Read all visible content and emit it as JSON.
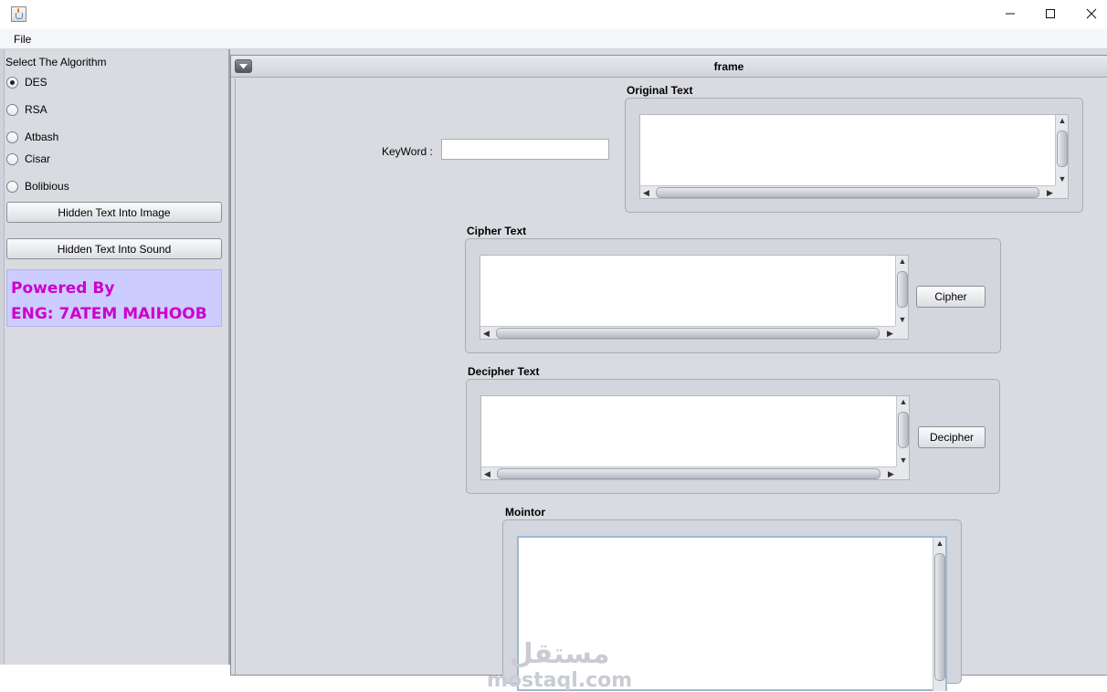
{
  "window": {
    "title": "",
    "icon": "java-cup-icon",
    "controls": [
      "minimize",
      "maximize",
      "close"
    ]
  },
  "menu": {
    "file": "File"
  },
  "sidebar": {
    "title": "Select The Algorithm",
    "algorithms": [
      {
        "label": "DES",
        "selected": true
      },
      {
        "label": "RSA",
        "selected": false
      },
      {
        "label": "Atbash",
        "selected": false
      },
      {
        "label": "Cisar",
        "selected": false
      },
      {
        "label": "Bolibious",
        "selected": false
      }
    ],
    "buttons": {
      "image": "Hidden Text Into Image",
      "sound": "Hidden Text Into Sound"
    },
    "credits": {
      "line1": "Powered By",
      "line2": "ENG: 7ATEM MAIHOOB",
      "background": "#ccccff",
      "color": "#cc00cc"
    }
  },
  "frame": {
    "title": "frame",
    "keyword": {
      "label": "KeyWord :",
      "value": "",
      "placeholder": ""
    },
    "original": {
      "title": "Original Text",
      "value": ""
    },
    "cipher": {
      "title": "Cipher Text",
      "value": "",
      "button": "Cipher"
    },
    "decipher": {
      "title": "Decipher Text",
      "value": "",
      "button": "Decipher"
    },
    "monitor": {
      "title": "Mointor",
      "value": ""
    }
  },
  "watermark": {
    "arabic": "مستقل",
    "latin": "mostaql.com"
  },
  "colors": {
    "panel_bg": "#d9dbe0",
    "textarea_bg": "#ffffff"
  }
}
